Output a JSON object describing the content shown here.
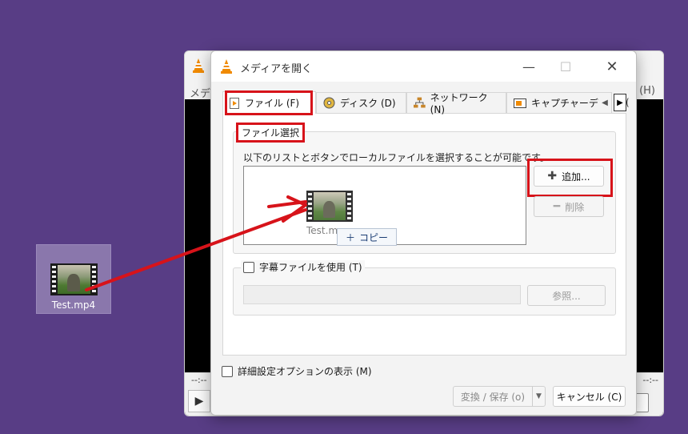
{
  "desktop": {
    "file_name": "Test.mp4"
  },
  "main_window": {
    "menu_left": "メディ",
    "menu_right": "(H)",
    "time_left": "--:--",
    "time_right": "--:--"
  },
  "dialog": {
    "title": "メディアを開く",
    "tabs": [
      {
        "label": "ファイル (F)",
        "icon": "file-play-icon"
      },
      {
        "label": "ディスク (D)",
        "icon": "disc-icon"
      },
      {
        "label": "ネットワーク (N)",
        "icon": "network-icon"
      },
      {
        "label": "キャプチャーデ",
        "icon": "capture-icon"
      }
    ],
    "tab_overflow_text": "(",
    "file_group": {
      "legend": "ファイル選択",
      "hint": "以下のリストとボタンでローカルファイルを選択することが可能です。",
      "drag_file_name": "Test.m",
      "copy_badge": "コピー",
      "add_button": "追加...",
      "remove_button": "削除"
    },
    "subtitle": {
      "checkbox_label": "字幕ファイルを使用 (T)",
      "browse_button": "参照..."
    },
    "advanced_label": "詳細設定オプションの表示 (M)",
    "convert_button": "変換 / 保存 (o)",
    "cancel_button": "キャンセル (C)"
  },
  "colors": {
    "desktop_bg": "#583d85",
    "highlight_red": "#d7131a",
    "vlc_orange": "#f08a00"
  }
}
